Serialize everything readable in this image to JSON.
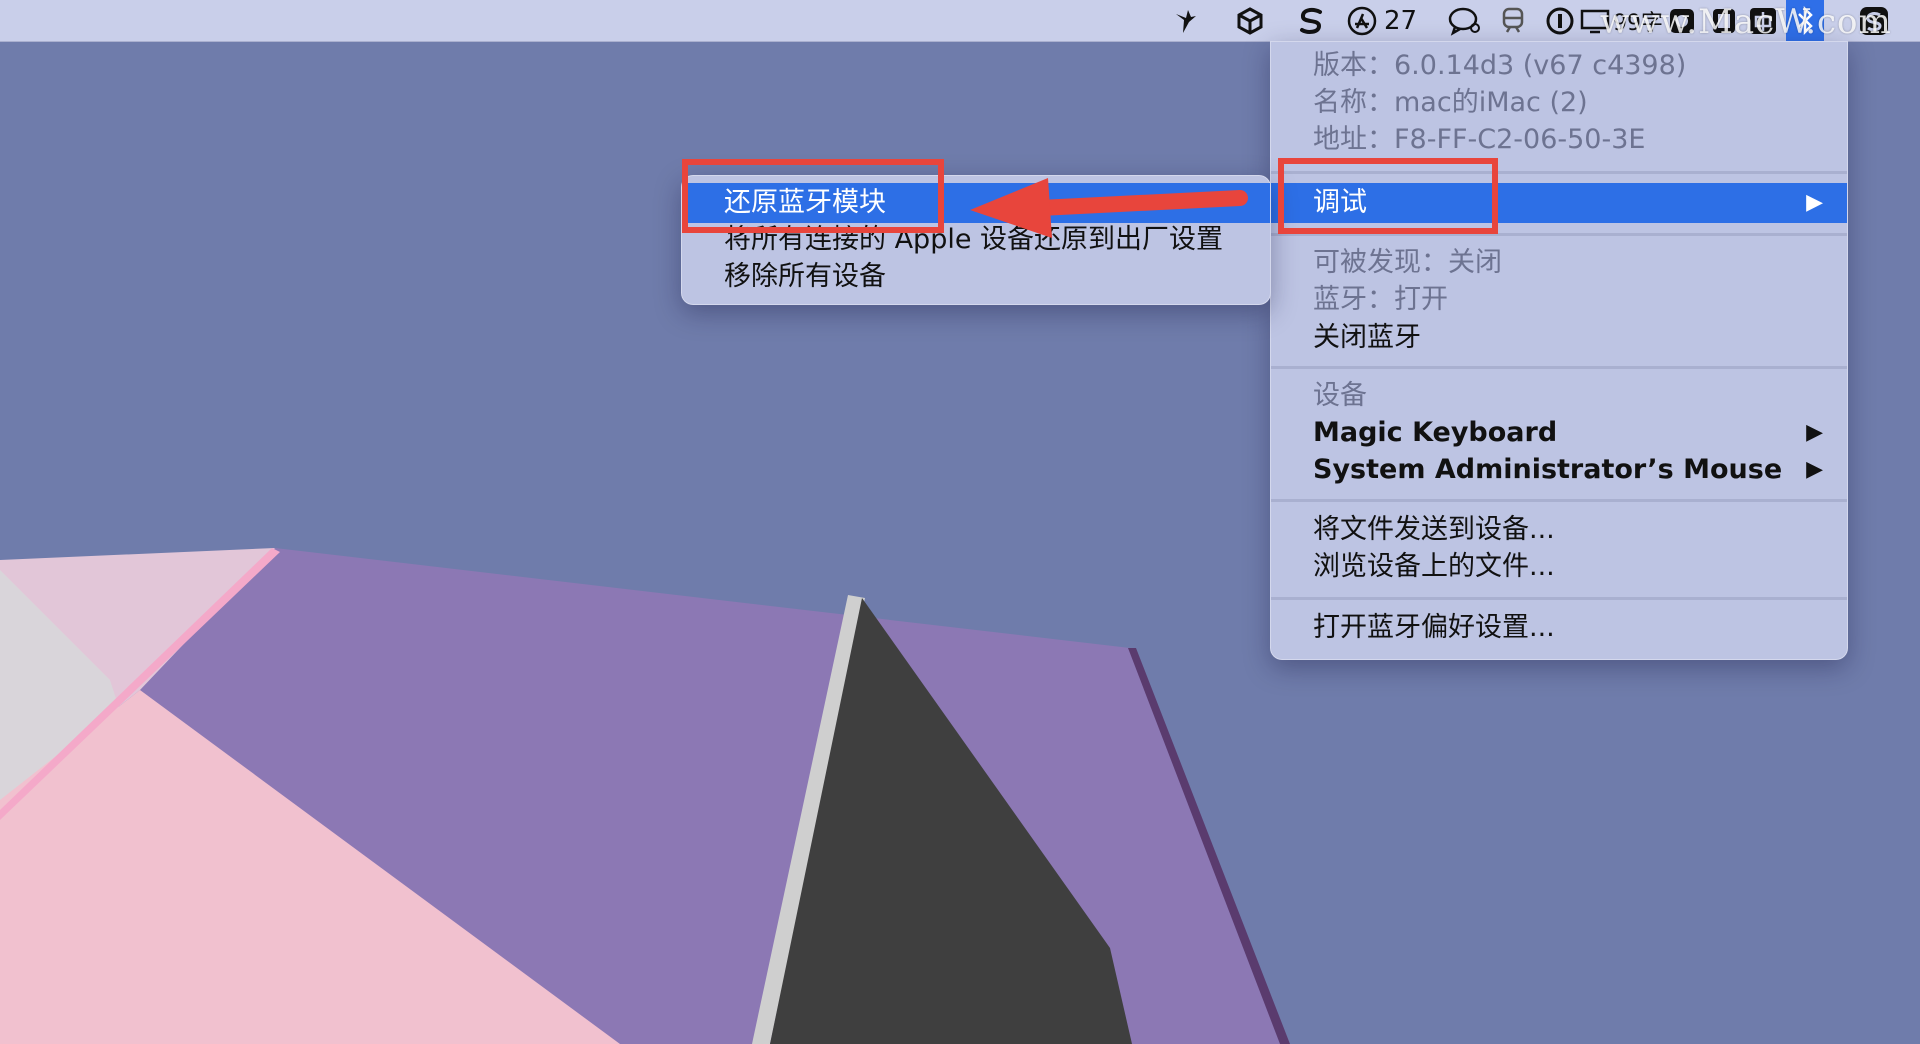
{
  "menubar": {
    "update_count": "27",
    "status_text": "99字",
    "watermark": "www.MacW.com"
  },
  "main_menu": {
    "version": "版本：6.0.14d3 (v67 c4398)",
    "name": "名称：mac的iMac (2)",
    "address": "地址：F8-FF-C2-06-50-3E",
    "debug": "调试",
    "discoverable": "可被发现：关闭",
    "bluetooth_state": "蓝牙：打开",
    "turn_off": "关闭蓝牙",
    "devices_header": "设备",
    "device_1": "Magic Keyboard",
    "device_2": "System Administrator’s Mouse",
    "send_file": "将文件发送到设备...",
    "browse_files": "浏览设备上的文件...",
    "open_prefs": "打开蓝牙偏好设置...",
    "arrow": "▶"
  },
  "sub_menu": {
    "reset_module": "还原蓝牙模块",
    "factory_reset": "将所有连接的 Apple 设备还原到出厂设置",
    "remove_all": "移除所有设备"
  },
  "colors": {
    "highlight": "#2d6fe6",
    "annotation": "#e8453c",
    "menu_bg": "#bdc4e3"
  }
}
